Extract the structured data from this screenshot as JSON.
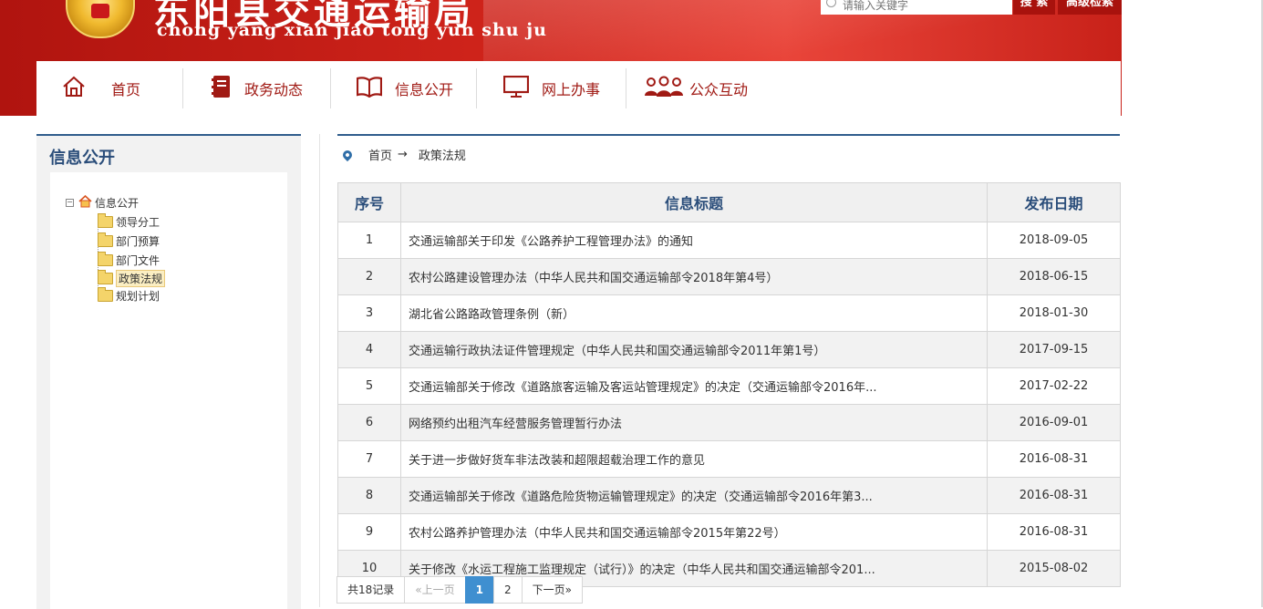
{
  "header": {
    "title_cn": "东阳县交通运输局",
    "title_pinyin": "chong yang xian jiao tong yun shu ju",
    "search_placeholder": "请输入关键字",
    "search_button": "搜 索",
    "advanced_button": "高级检索"
  },
  "nav": [
    {
      "label": "首页",
      "icon": "home-icon"
    },
    {
      "label": "政务动态",
      "icon": "notebook-icon"
    },
    {
      "label": "信息公开",
      "icon": "open-book-icon"
    },
    {
      "label": "网上办事",
      "icon": "monitor-icon"
    },
    {
      "label": "公众互动",
      "icon": "people-icon"
    }
  ],
  "sidebar": {
    "title": "信息公开",
    "tree_root": "信息公开",
    "tree_items": [
      "领导分工",
      "部门预算",
      "部门文件",
      "政策法规",
      "规划计划"
    ],
    "selected": "政策法规"
  },
  "breadcrumb": {
    "home": "首页",
    "separator": "→",
    "current": "政策法规"
  },
  "table": {
    "headers": [
      "序号",
      "信息标题",
      "发布日期"
    ],
    "rows": [
      {
        "no": "1",
        "title": "交通运输部关于印发《公路养护工程管理办法》的通知",
        "date": "2018-09-05"
      },
      {
        "no": "2",
        "title": "农村公路建设管理办法（中华人民共和国交通运输部令2018年第4号）",
        "date": "2018-06-15"
      },
      {
        "no": "3",
        "title": "湖北省公路路政管理条例（新）",
        "date": "2018-01-30"
      },
      {
        "no": "4",
        "title": "交通运输行政执法证件管理规定（中华人民共和国交通运输部令2011年第1号）",
        "date": "2017-09-15"
      },
      {
        "no": "5",
        "title": "交通运输部关于修改《道路旅客运输及客运站管理规定》的决定（交通运输部令2016年...",
        "date": "2017-02-22"
      },
      {
        "no": "6",
        "title": "网络预约出租汽车经营服务管理暂行办法",
        "date": "2016-09-01"
      },
      {
        "no": "7",
        "title": "关于进一步做好货车非法改装和超限超载治理工作的意见",
        "date": "2016-08-31"
      },
      {
        "no": "8",
        "title": "交通运输部关于修改《道路危险货物运输管理规定》的决定（交通运输部令2016年第3...",
        "date": "2016-08-31"
      },
      {
        "no": "9",
        "title": "农村公路养护管理办法（中华人民共和国交通运输部令2015年第22号）",
        "date": "2016-08-31"
      },
      {
        "no": "10",
        "title": "关于修改《水运工程施工监理规定（试行）》的决定（中华人民共和国交通运输部令201...",
        "date": "2015-08-02"
      }
    ]
  },
  "pagination": {
    "total": "共18记录",
    "prev": "«上一页",
    "pages": [
      "1",
      "2"
    ],
    "current": "1",
    "next": "下一页»"
  },
  "colors": {
    "brand_red": "#c8201a",
    "nav_text": "#a01a14",
    "accent_blue": "#2f5c8c",
    "active_page": "#3f8fd0"
  }
}
